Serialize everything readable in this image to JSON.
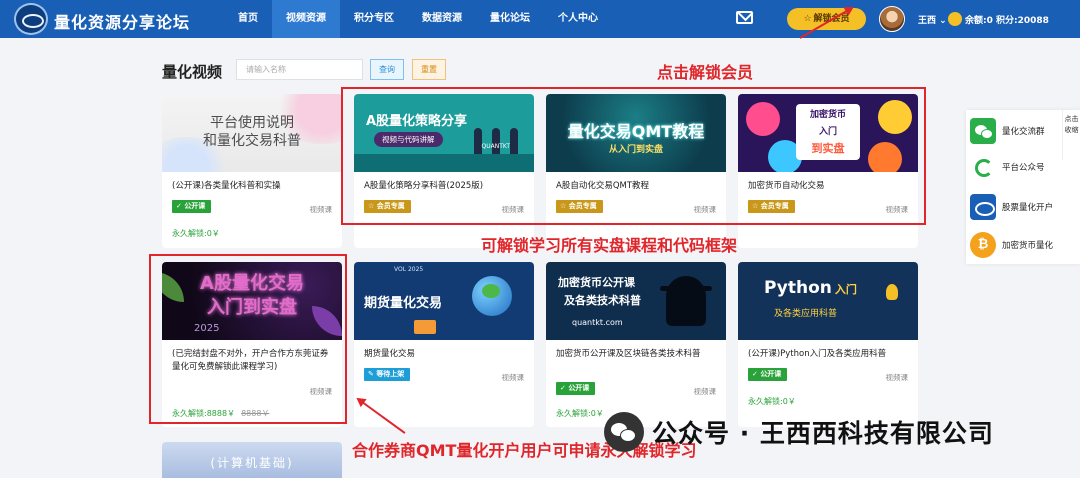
{
  "header": {
    "brand": "量化资源分享论坛",
    "nav": [
      "首页",
      "视频资源",
      "积分专区",
      "数据资源",
      "量化论坛",
      "个人中心"
    ],
    "active_nav": 1,
    "unlock_label": "解锁会员",
    "user_name": "王西",
    "balance_text": "余额:0 积分:20088"
  },
  "search": {
    "title": "量化视频",
    "placeholder": "请输入名称",
    "query_label": "查询",
    "reset_label": "重置"
  },
  "cards": [
    {
      "thumb_lines": [
        "平台使用说明",
        "和量化交易科普"
      ],
      "title": "(公开课)各类量化科普和实操",
      "badge": "公开课",
      "type": "视频课",
      "price": "永久解锁:0￥"
    },
    {
      "thumb_title": "A股量化策略分享",
      "thumb_sub": "视频与代码讲解",
      "thumb_logo": "QUANTKT",
      "title": "A股量化策略分享科普(2025版)",
      "badge": "会员专属",
      "type": "视频课"
    },
    {
      "thumb_title": "量化交易QMT教程",
      "thumb_sub": "从入门到实盘",
      "title": "A股自动化交易QMT教程",
      "badge": "会员专属",
      "type": "视频课"
    },
    {
      "thumb_lines": [
        "加密货币",
        "入门",
        "到实盘"
      ],
      "title": "加密货币自动化交易",
      "badge": "会员专属",
      "type": "视频课"
    },
    {
      "thumb_lines": [
        "A股量化交易",
        "入门到实盘"
      ],
      "thumb_year": "2025",
      "title": "(已完结封盘不对外，开户合作方东莞证券量化可免费解锁此课程学习)",
      "type": "视频课",
      "price": "永久解锁:8888￥",
      "price_old": "8888￥"
    },
    {
      "thumb_title": "期货量化交易",
      "thumb_year": "VOL 2025",
      "title": "期货量化交易",
      "badge": "等待上架",
      "type": "视频课"
    },
    {
      "thumb_lines": [
        "加密货币公开课",
        "及各类技术科普"
      ],
      "thumb_url": "quantkt.com",
      "title": "加密货币公开课及区块链各类技术科普",
      "badge": "公开课",
      "type": "视频课",
      "price": "永久解锁:0￥"
    },
    {
      "thumb_title": "Python",
      "thumb_title_small": "入门",
      "thumb_sub": "及各类应用科普",
      "title": "(公开课)Python入门及各类应用科普",
      "badge": "公开课",
      "type": "视频课",
      "price": "永久解锁:0￥"
    },
    {
      "thumb_title": "(计算机基础)"
    }
  ],
  "side_panel": {
    "items": [
      "量化交流群",
      "平台公众号",
      "股票量化开户",
      "加密货币量化"
    ],
    "tab_label": "点击收缩"
  },
  "annotations": {
    "unlock": "点击解锁会员",
    "all_courses": "可解锁学习所有实盘课程和代码框架",
    "broker": "合作券商QMT量化开户用户可申请永久解锁学习",
    "watermark": "公众号 · 王西西科技有限公司"
  }
}
